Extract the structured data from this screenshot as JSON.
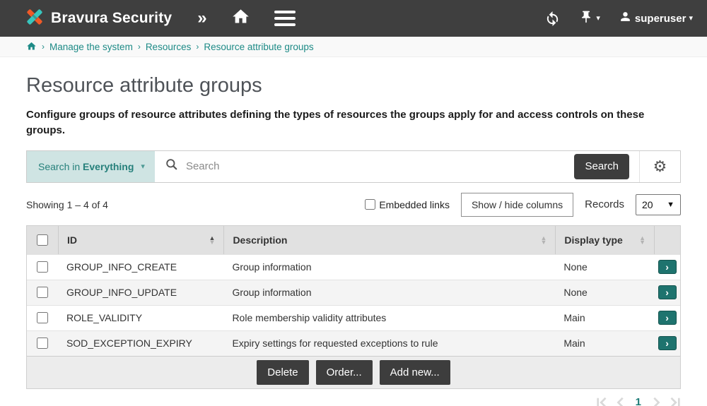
{
  "navbar": {
    "brand": "Bravura Security",
    "username": "superuser"
  },
  "breadcrumb": {
    "items": [
      "Manage the system",
      "Resources",
      "Resource attribute groups"
    ]
  },
  "page": {
    "title": "Resource attribute groups",
    "description": "Configure groups of resource attributes defining the types of resources the groups apply for and access controls on these groups."
  },
  "search": {
    "scope_prefix": "Search in",
    "scope_value": "Everything",
    "placeholder": "Search",
    "button_label": "Search"
  },
  "controls": {
    "showing": "Showing 1 – 4 of 4",
    "embedded_links_label": "Embedded links",
    "show_hide_label": "Show / hide columns",
    "records_label": "Records",
    "records_value": "20"
  },
  "table": {
    "columns": {
      "id": "ID",
      "description": "Description",
      "display_type": "Display type"
    },
    "rows": [
      {
        "id": "GROUP_INFO_CREATE",
        "description": "Group information",
        "display_type": "None"
      },
      {
        "id": "GROUP_INFO_UPDATE",
        "description": "Group information",
        "display_type": "None"
      },
      {
        "id": "ROLE_VALIDITY",
        "description": "Role membership validity attributes",
        "display_type": "Main"
      },
      {
        "id": "SOD_EXCEPTION_EXPIRY",
        "description": "Expiry settings for requested exceptions to rule",
        "display_type": "Main"
      }
    ],
    "footer_buttons": {
      "delete": "Delete",
      "order": "Order...",
      "add_new": "Add new..."
    }
  },
  "pagination": {
    "current_page": "1"
  },
  "colors": {
    "navbar_bg": "#3f3f3f",
    "accent_teal": "#1d7b77",
    "logo_orange": "#f05a28",
    "logo_teal": "#38c6be",
    "button_dark": "#3d3d3d",
    "row_alt_bg": "#f4f4f4",
    "header_bg": "#e1e1e1",
    "scope_bg": "#cfe4e3"
  }
}
